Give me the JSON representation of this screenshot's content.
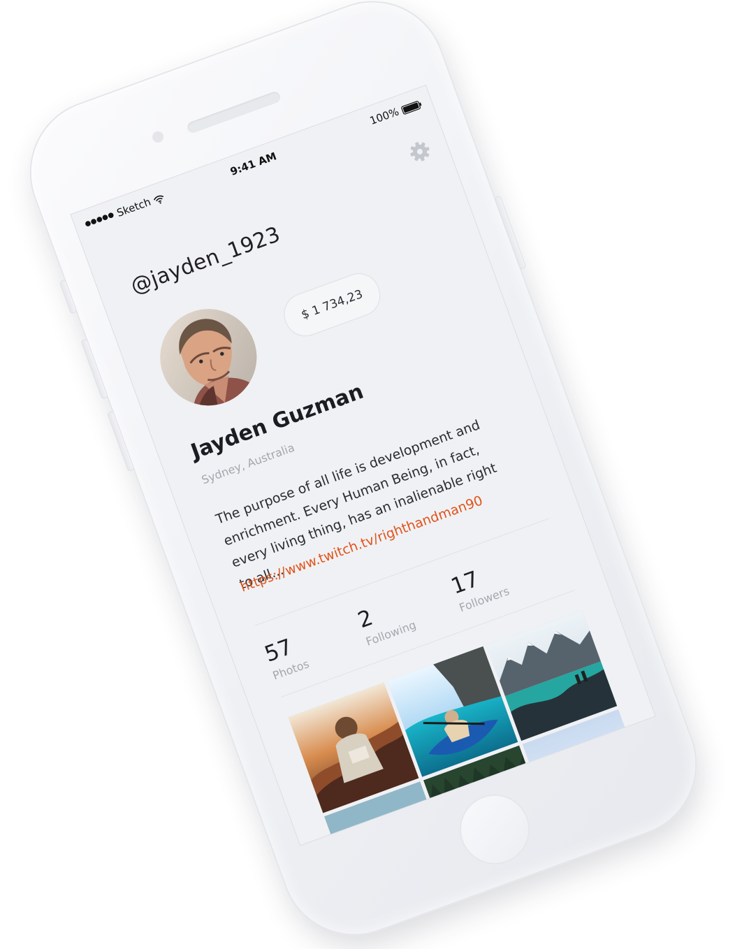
{
  "status_bar": {
    "carrier": "Sketch",
    "time": "9:41 AM",
    "battery": "100%"
  },
  "profile": {
    "username": "@jayden_1923",
    "balance": "$ 1 734,23",
    "name": "Jayden Guzman",
    "location": "Sydney, Australia",
    "bio": "The purpose of all life is development and enrichment. Every Human Being, in fact, every living thing, has an inalienable right to all...",
    "link": "https://www.twitch.tv/righthandman90",
    "stats": [
      {
        "value": "57",
        "label": "Photos"
      },
      {
        "value": "2",
        "label": "Following"
      },
      {
        "value": "17",
        "label": "Followers"
      }
    ]
  },
  "icons": {
    "settings": "gear-icon",
    "wifi": "wifi-icon",
    "battery": "battery-icon"
  },
  "colors": {
    "accent": "#e0541b",
    "screen_background": "#f0f1f4",
    "phone_body": "#eef0f4"
  },
  "photos": [
    {
      "id": "backpack-sunset"
    },
    {
      "id": "kayak-cliff"
    },
    {
      "id": "mountain-lake"
    },
    {
      "id": "car-window"
    },
    {
      "id": "forest"
    },
    {
      "id": "sky"
    }
  ]
}
